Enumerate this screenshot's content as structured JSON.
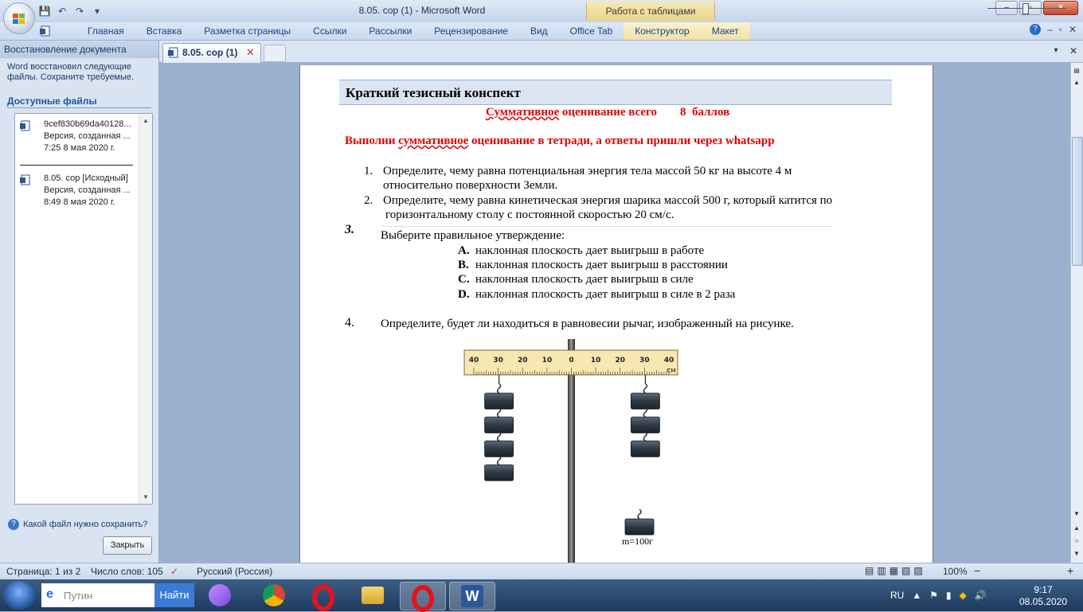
{
  "window": {
    "title": "8.05. сор (1) - Microsoft Word",
    "context_tab_group": "Работа с таблицами",
    "controls": [
      "–",
      "▫",
      "✕"
    ]
  },
  "qat": {
    "save_icon": "save-icon",
    "undo_icon": "undo-icon",
    "redo_icon": "redo-icon",
    "more": "▾"
  },
  "ribbon": {
    "tabs": [
      "Главная",
      "Вставка",
      "Разметка страницы",
      "Ссылки",
      "Рассылки",
      "Рецензирование",
      "Вид",
      "Office Tab",
      "Конструктор",
      "Макет"
    ],
    "help": "?",
    "min": "–",
    "restore": "▫",
    "close": "✕"
  },
  "doc_tabs": {
    "active": "8.05. сор (1)",
    "close": "✕",
    "dropdown": "▾",
    "x": "✕"
  },
  "recovery_pane": {
    "title": "Восстановление документа",
    "message": "Word восстановил следующие файлы.  Сохраните требуемые.",
    "available": "Доступные файлы",
    "files": [
      {
        "name": "9cef830b69da40128...",
        "version": "Версия, созданная ...",
        "time": "7:25 8 мая 2020 г."
      },
      {
        "name": "8.05. сор  [Исходный]",
        "version": "Версия, созданная ...",
        "time": "8:49 8 мая 2020 г."
      }
    ],
    "help_question": "Какой файл нужно сохранить?",
    "close_button": "Закрыть"
  },
  "document": {
    "header": "Краткий тезисный конспект",
    "summative_a": "Суммативное",
    "summative_b": " оценивание всего",
    "summative_pts": "8  баллов",
    "instruction_a": "Выполни ",
    "instruction_b": "суммативное",
    "instruction_c": " оценивание в тетради, а ответы пришли через whatsapp",
    "questions": [
      {
        "num": "1.",
        "lines": [
          "Определите, чему равна потенциальная энергия тела массой 50 кг на высоте 4 м",
          "относительно поверхности Земли."
        ]
      },
      {
        "num": "2.",
        "lines": [
          "Определите, чему равна кинетическая энергия шарика массой 500 г, который катится по",
          "горизонтальному столу с постоянной скоростью 20 см/с."
        ]
      },
      {
        "num": "3.",
        "lines": [
          "Выберите правильное утверждение:"
        ]
      },
      {
        "num": "4.",
        "lines": [
          "Определите, будет ли находиться в равновесии рычаг, изображенный на рисунке."
        ]
      }
    ],
    "answers": [
      {
        "letter": "A.",
        "text": "наклонная плоскость дает выигрыш в работе"
      },
      {
        "letter": "B.",
        "text": "наклонная плоскость дает выигрыш в расстоянии"
      },
      {
        "letter": "C.",
        "text": "наклонная плоскость дает выигрыш в силе"
      },
      {
        "letter": "D.",
        "text": "наклонная плоскость дает выигрыш в силе в 2 раза"
      }
    ],
    "figure": {
      "ruler_labels": [
        "40",
        "30",
        "20",
        "10",
        "0",
        "10",
        "20",
        "30",
        "40"
      ],
      "unit": "см",
      "mass_label": "m=100г",
      "left_weights": 4,
      "right_weights": 3
    }
  },
  "status": {
    "page": "Страница: 1 из 2",
    "words": "Число слов: 105",
    "language": "Русский (Россия)",
    "zoom": "100%",
    "zoom_minus": "−",
    "zoom_plus": "+"
  },
  "taskbar": {
    "search_placeholder": "Путин",
    "search_button": "Найти",
    "lang": "RU",
    "time": "9:17",
    "date": "08.05.2020"
  }
}
